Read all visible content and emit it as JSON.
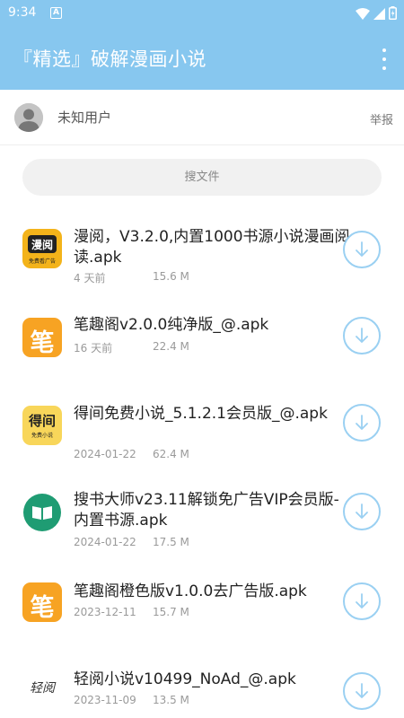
{
  "status_bar": {
    "time": "9:34",
    "notification_icon": "A",
    "icons": [
      "wifi-icon",
      "signal-icon",
      "battery-icon"
    ]
  },
  "app_bar": {
    "title": "『精选』破解漫画小说",
    "menu_icon": "more-vert-icon",
    "color": "#87c7ef"
  },
  "user": {
    "name": "未知用户",
    "report_label": "举报"
  },
  "search": {
    "placeholder": "搜文件"
  },
  "files": [
    {
      "name": "漫阅，V3.2.0,内置1000书源小说漫画阅读.apk",
      "date": "4 天前",
      "size": "15.6 M",
      "icon": "manyue-app-icon",
      "icon_text": "漫阅",
      "icon_sub": "免费看广告"
    },
    {
      "name": "笔趣阁v2.0.0纯净版_@.apk",
      "date": "16 天前",
      "size": "22.4 M",
      "icon": "biquge-app-icon",
      "icon_text": "笔"
    },
    {
      "name": "得间免费小说_5.1.2.1会员版_@.apk",
      "date": "2024-01-22",
      "size": "62.4 M",
      "icon": "dejian-app-icon",
      "icon_text": "得间",
      "icon_sub": "免费小说"
    },
    {
      "name": "搜书大师v23.11解锁免广告VIP会员版-内置书源.apk",
      "date": "2024-01-22",
      "size": "17.5 M",
      "icon": "book-icon"
    },
    {
      "name": "笔趣阁橙色版v1.0.0去广告版.apk",
      "date": "2023-12-11",
      "size": "15.7 M",
      "icon": "biquge-app-icon",
      "icon_text": "笔"
    },
    {
      "name": "轻阅小说v10499_NoAd_@.apk",
      "date": "2023-11-09",
      "size": "13.5 M",
      "icon": "qingyue-app-icon",
      "icon_text": "轻阅"
    }
  ]
}
